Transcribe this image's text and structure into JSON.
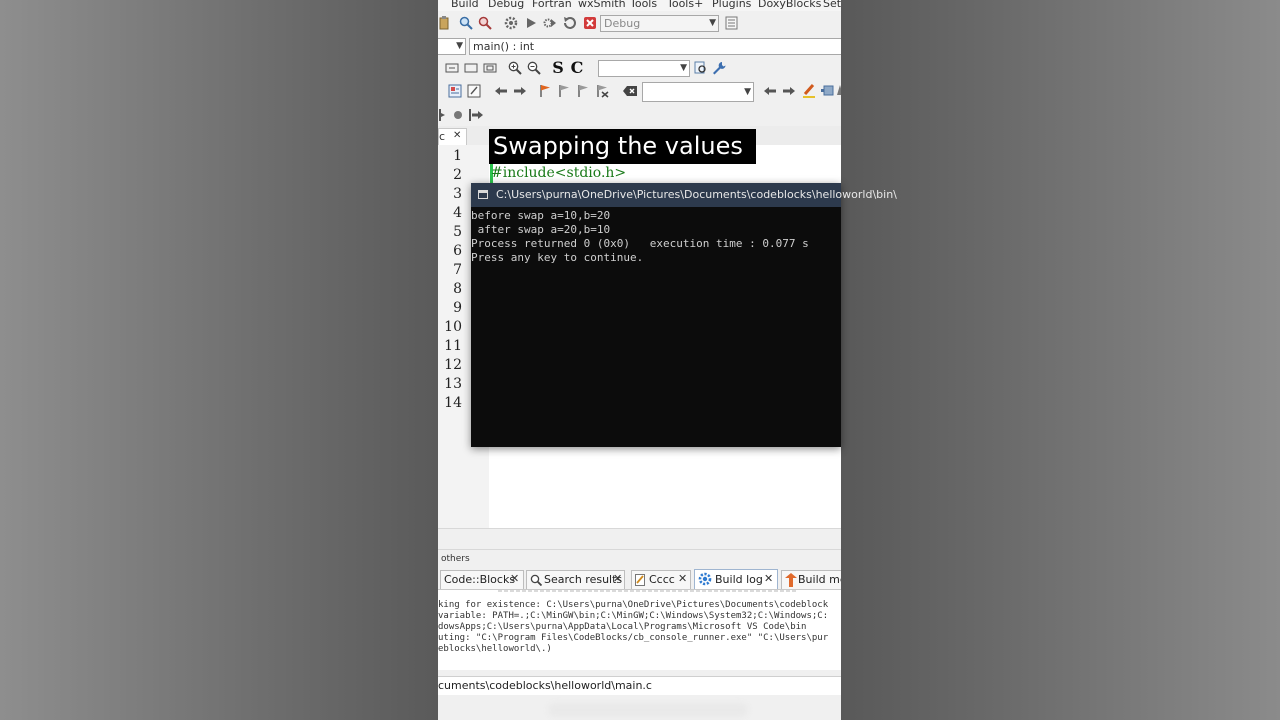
{
  "menu": [
    "Build",
    "Debug",
    "Fortran",
    "wxSmith",
    "Tools",
    "Tools+",
    "Plugins",
    "DoxyBlocks",
    "Sett"
  ],
  "toolbar": {
    "build_target": "Debug",
    "scope_value": "main() : int"
  },
  "editor": {
    "tab_label": "c",
    "tab_close": "✕",
    "line_numbers": [
      "1",
      "2",
      "3",
      "4",
      "5",
      "6",
      "7",
      "8",
      "9",
      "10",
      "11",
      "12",
      "13",
      "14"
    ],
    "line2_code": "#include<stdio.h>"
  },
  "caption": "Swapping the values",
  "console": {
    "title": "C:\\Users\\purna\\OneDrive\\Pictures\\Documents\\codeblocks\\helloworld\\bin\\",
    "lines": [
      "before swap a=10,b=20",
      " after swap a=20,b=10",
      "Process returned 0 (0x0)   execution time : 0.077 s",
      "Press any key to continue."
    ]
  },
  "logs": {
    "title": "others",
    "tabs": [
      {
        "label": "Code::Blocks",
        "icon": "none"
      },
      {
        "label": "Search results",
        "icon": "search-icon"
      },
      {
        "label": "Cccc",
        "icon": "pencil-icon"
      },
      {
        "label": "Build log",
        "icon": "gear-icon"
      },
      {
        "label": "Build mes",
        "icon": "build-messages-icon"
      }
    ],
    "lines": [
      "king for existence: C:\\Users\\purna\\OneDrive\\Pictures\\Documents\\codeblock",
      "variable: PATH=.;C:\\MinGW\\bin;C:\\MinGW;C:\\Windows\\System32;C:\\Windows;C:",
      "dowsApps;C:\\Users\\purna\\AppData\\Local\\Programs\\Microsoft VS Code\\bin",
      "uting: \"C:\\Program Files\\CodeBlocks/cb_console_runner.exe\" \"C:\\Users\\pur",
      "eblocks\\helloworld\\.)"
    ],
    "close_glyph": "✕"
  },
  "statusbar": {
    "path": "cuments\\codeblocks\\helloworld\\main.c"
  },
  "colors": {
    "console_bg": "#0c0c0c",
    "console_title_bg": "#2d3a4d",
    "change_bar": "#2cc24d",
    "build_log_tab_border": "#9fb5d0"
  }
}
